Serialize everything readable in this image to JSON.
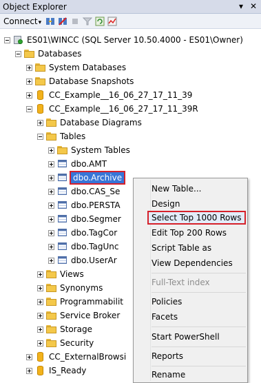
{
  "window": {
    "title": "Object Explorer",
    "pin_glyph": "▾ ᵻ",
    "close_glyph": "✕"
  },
  "toolbar": {
    "connect_label": "Connect",
    "connect_caret": "▾"
  },
  "tree": {
    "server": "ES01\\WINCC (SQL Server 10.50.4000 - ES01\\Owner)",
    "databases": "Databases",
    "system_databases": "System Databases",
    "database_snapshots": "Database Snapshots",
    "db1": "CC_Example__16_06_27_17_11_39",
    "db2": "CC_Example__16_06_27_17_11_39R",
    "database_diagrams": "Database Diagrams",
    "tables": "Tables",
    "system_tables": "System Tables",
    "t_amt": "dbo.AMT",
    "t_archive": "dbo.Archive",
    "t_cas": "dbo.CAS_Se",
    "t_persta": "dbo.PERSTA",
    "t_segmen": "dbo.Segmer",
    "t_tagcon": "dbo.TagCor",
    "t_tagunc": "dbo.TagUnc",
    "t_userar": "dbo.UserAr",
    "views": "Views",
    "synonyms": "Synonyms",
    "programmability": "Programmabilit",
    "service_broker": "Service Broker",
    "storage": "Storage",
    "security": "Security",
    "db3": "CC_ExternalBrowsi",
    "db4": "IS_Ready"
  },
  "context_menu": {
    "new_table": "New Table...",
    "design": "Design",
    "select_top": "Select Top 1000 Rows",
    "edit_top": "Edit Top 200 Rows",
    "script_table": "Script Table as",
    "view_deps": "View Dependencies",
    "fulltext": "Full-Text index",
    "policies": "Policies",
    "facets": "Facets",
    "powershell": "Start PowerShell",
    "reports": "Reports",
    "rename": "Rename"
  }
}
